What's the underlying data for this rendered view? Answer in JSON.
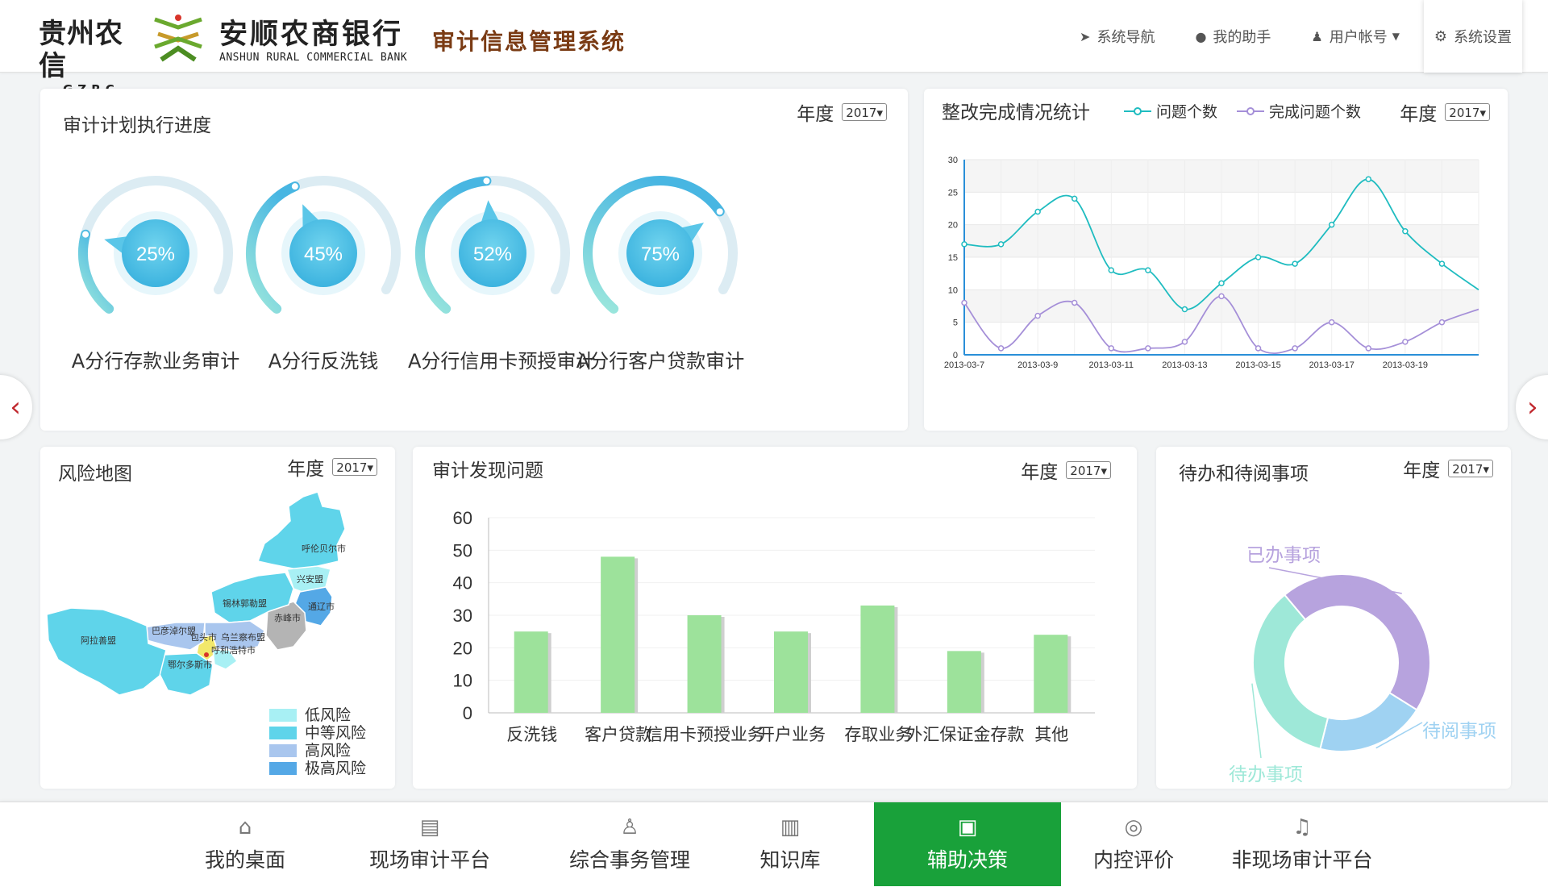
{
  "header": {
    "logo_gz_cn": "贵州农信",
    "logo_gz_en": "GZRC",
    "bank_cn": "安顺农商银行",
    "bank_en": "ANSHUN RURAL COMMERCIAL BANK",
    "system_title": "审计信息管理系统",
    "nav": {
      "system_nav": "系统导航",
      "assistant": "我的助手",
      "account": "用户帐号",
      "settings": "系统设置"
    }
  },
  "year_label": "年度",
  "year_value": "2017",
  "progress_panel": {
    "title": "审计计划执行进度",
    "gauges": [
      {
        "label": "A分行存款业务审计",
        "value": 25,
        "text": "25%"
      },
      {
        "label": "A分行反洗钱",
        "value": 45,
        "text": "45%"
      },
      {
        "label": "A分行信用卡预授审计",
        "value": 52,
        "text": "52%"
      },
      {
        "label": "A分行客户贷款审计",
        "value": 75,
        "text": "75%"
      }
    ]
  },
  "rectify_panel": {
    "title": "整改完成情况统计",
    "legend": [
      "问题个数",
      "完成问题个数"
    ]
  },
  "risk_panel": {
    "title": "风险地图",
    "regions": [
      "呼伦贝尔市",
      "兴安盟",
      "通辽市",
      "赤峰市",
      "锡林郭勒盟",
      "乌兰察布盟",
      "呼和浩特市",
      "包头市",
      "巴彦淖尔盟",
      "鄂尔多斯市",
      "阿拉善盟"
    ],
    "legend": [
      {
        "label": "低风险",
        "color": "#a8f0f4"
      },
      {
        "label": "中等风险",
        "color": "#5fd4ea"
      },
      {
        "label": "高风险",
        "color": "#a9c6ee"
      },
      {
        "label": "极高风险",
        "color": "#54a8e6"
      }
    ]
  },
  "issues_panel": {
    "title": "审计发现问题"
  },
  "todo_panel": {
    "title": "待办和待阅事项",
    "labels": {
      "done": "已办事项",
      "to_read": "待阅事项",
      "todo": "待办事项"
    }
  },
  "chart_data": [
    {
      "type": "line",
      "x": [
        "2013-03-7",
        "2013-03-8",
        "2013-03-9",
        "2013-03-10",
        "2013-03-11",
        "2013-03-12",
        "2013-03-13",
        "2013-03-14",
        "2013-03-15",
        "2013-03-16",
        "2013-03-17",
        "2013-03-18",
        "2013-03-19",
        "2013-03-20",
        "2013-03-21"
      ],
      "xticks": [
        "2013-03-7",
        "2013-03-9",
        "2013-03-11",
        "2013-03-13",
        "2013-03-15",
        "2013-03-17",
        "2013-03-19"
      ],
      "series": [
        {
          "name": "问题个数",
          "color": "#1fbcc0",
          "values": [
            17,
            17,
            22,
            24,
            13,
            13,
            7,
            11,
            15,
            14,
            20,
            27,
            19,
            14,
            10
          ]
        },
        {
          "name": "完成问题个数",
          "color": "#a58fd8",
          "values": [
            8,
            1,
            6,
            8,
            1,
            1,
            2,
            9,
            1,
            1,
            5,
            1,
            2,
            5,
            7
          ]
        }
      ],
      "ylim": [
        0,
        30
      ],
      "yticks": [
        0,
        5,
        10,
        15,
        20,
        25,
        30
      ]
    },
    {
      "type": "bar",
      "categories": [
        "反洗钱",
        "客户贷款",
        "信用卡预授业务",
        "开户业务",
        "存取业务",
        "外汇保证金存款",
        "其他"
      ],
      "values": [
        25,
        48,
        30,
        25,
        33,
        19,
        24
      ],
      "color": "#9de29b",
      "ylim": [
        0,
        60
      ],
      "yticks": [
        0,
        10,
        20,
        30,
        40,
        50,
        60
      ]
    },
    {
      "type": "pie",
      "categories": [
        "已办事项",
        "待阅事项",
        "待办事项"
      ],
      "values": [
        45,
        20,
        35
      ],
      "colors": [
        "#b7a3de",
        "#9fd2f2",
        "#9ee8d8"
      ]
    }
  ],
  "bottom_nav": [
    {
      "label": "我的桌面",
      "icon": "home-icon",
      "glyph": "⌂"
    },
    {
      "label": "现场审计平台",
      "icon": "notebook-icon",
      "glyph": "▤"
    },
    {
      "label": "综合事务管理",
      "icon": "user-icon",
      "glyph": "♙"
    },
    {
      "label": "知识库",
      "icon": "book-icon",
      "glyph": "▥"
    },
    {
      "label": "辅助决策",
      "icon": "decision-icon",
      "glyph": "▣"
    },
    {
      "label": "内控评价",
      "icon": "evaluation-icon",
      "glyph": "◎"
    },
    {
      "label": "非现场审计平台",
      "icon": "bell-icon",
      "glyph": "♫"
    }
  ]
}
